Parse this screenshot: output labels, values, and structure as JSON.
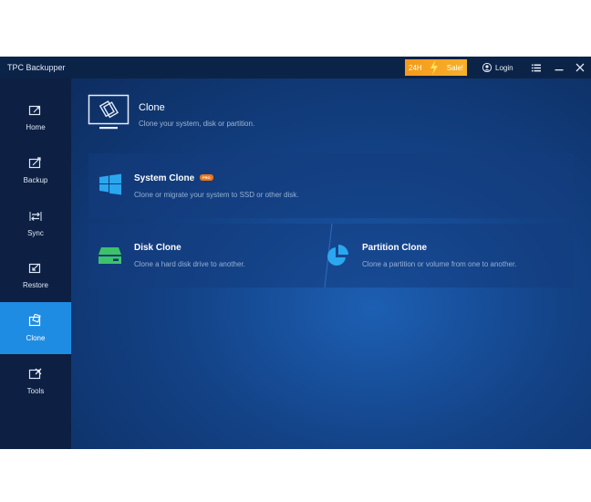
{
  "window": {
    "title": "TPC Backupper"
  },
  "titlebar": {
    "sale_left": "24H",
    "sale_right": "Sale!",
    "login_label": "Login"
  },
  "icons": {
    "menu": "menu-icon",
    "minimize": "minimize-icon",
    "close": "close-icon",
    "user": "user-icon",
    "bolt": "lightning-bolt-icon"
  },
  "sidebar": {
    "items": [
      {
        "label": "Home",
        "icon": "home-icon",
        "active": false
      },
      {
        "label": "Backup",
        "icon": "backup-icon",
        "active": false
      },
      {
        "label": "Sync",
        "icon": "sync-icon",
        "active": false
      },
      {
        "label": "Restore",
        "icon": "restore-icon",
        "active": false
      },
      {
        "label": "Clone",
        "icon": "clone-icon",
        "active": true
      },
      {
        "label": "Tools",
        "icon": "tools-icon",
        "active": false
      }
    ]
  },
  "header": {
    "title": "Clone",
    "subtitle": "Clone your system, disk or partition."
  },
  "cards": {
    "system_clone": {
      "title": "System Clone",
      "badge": "PRO",
      "desc": "Clone or migrate your system to SSD or other disk."
    },
    "disk_clone": {
      "title": "Disk Clone",
      "desc": "Clone a hard disk drive to another."
    },
    "partition_clone": {
      "title": "Partition Clone",
      "desc": "Clone a partition or volume from one to another."
    }
  },
  "colors": {
    "accent": "#1f8ce3",
    "sale": "#f59a1b",
    "pro_badge": "#e9771d",
    "sidebar_bg": "#0d2043",
    "titlebar_bg": "#0c2348",
    "disk_green": "#3cc36a",
    "windows_blue": "#2aa7ef"
  }
}
